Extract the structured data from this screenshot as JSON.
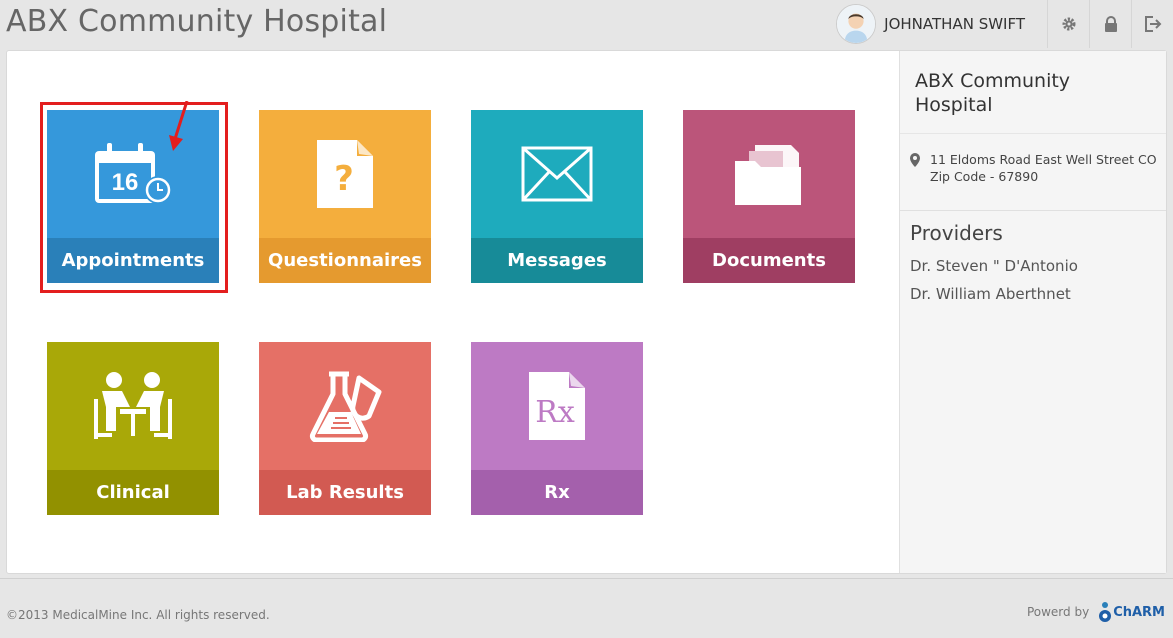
{
  "header": {
    "title": "ABX Community Hospital",
    "user_name": "JOHNATHAN SWIFT",
    "icons": [
      "gear-icon",
      "lock-icon",
      "logout-icon"
    ]
  },
  "tiles": [
    {
      "id": "appointments",
      "label": "Appointments",
      "icon": "calendar-icon",
      "calendar_day": "16",
      "color": "#3598db"
    },
    {
      "id": "questionnaires",
      "label": "Questionnaires",
      "icon": "question-document-icon",
      "color": "#f4ae3d"
    },
    {
      "id": "messages",
      "label": "Messages",
      "icon": "envelope-icon",
      "color": "#1eabbd"
    },
    {
      "id": "documents",
      "label": "Documents",
      "icon": "folder-icon",
      "color": "#bb557a"
    },
    {
      "id": "clinical",
      "label": "Clinical",
      "icon": "consultation-icon",
      "color": "#a9a808"
    },
    {
      "id": "lab-results",
      "label": "Lab Results",
      "icon": "flask-icon",
      "color": "#e57066"
    },
    {
      "id": "rx",
      "label": "Rx",
      "icon": "prescription-icon",
      "icon_text": "Rx",
      "color": "#bd7ac4"
    }
  ],
  "sidebar": {
    "hospital_name": "ABX Community Hospital",
    "address_line1": "11 Eldoms Road East Well Street CO",
    "address_line2": "Zip Code - 67890",
    "providers_title": "Providers",
    "providers": [
      "Dr. Steven \" D'Antonio",
      "Dr. William Aberthnet"
    ]
  },
  "annotation": {
    "highlight_color": "#e31e1e"
  },
  "footer": {
    "copyright": "©2013 MedicalMine Inc. All rights reserved.",
    "powered_by": "Powerd by",
    "logo_text": "ChARM"
  }
}
